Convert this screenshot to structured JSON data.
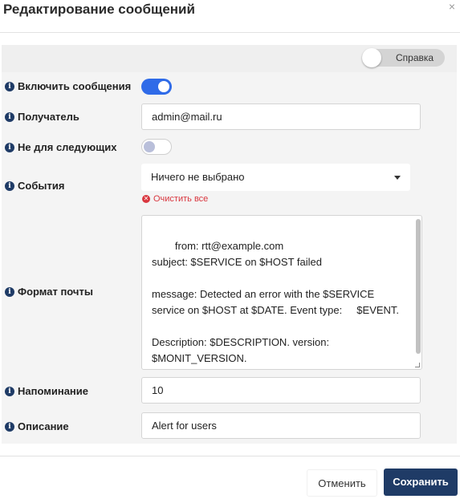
{
  "dialog": {
    "title": "Редактирование сообщений",
    "close_glyph": "×"
  },
  "help_toggle": {
    "label": "Справка",
    "enabled": false
  },
  "fields": {
    "enable_messages": {
      "label": "Включить сообщения",
      "enabled": true
    },
    "recipient": {
      "label": "Получатель",
      "value": "admin@mail.ru"
    },
    "not_for_following": {
      "label": "Не для следующих",
      "enabled": false
    },
    "events": {
      "label": "События",
      "value": "Ничего не выбрано",
      "clear_label": "Очистить все"
    },
    "mail_format": {
      "label": "Формат почты",
      "value": "from: rtt@example.com\nsubject: $SERVICE on $HOST failed\n\nmessage: Detected an error with the $SERVICE service on $HOST at $DATE. Event type:     $EVENT.\n\nDescription: $DESCRIPTION. version: $MONIT_VERSION."
    },
    "reminder": {
      "label": "Напоминание",
      "value": "10"
    },
    "description": {
      "label": "Описание",
      "value": "Alert for users"
    }
  },
  "footer": {
    "cancel_label": "Отменить",
    "save_label": "Сохранить"
  },
  "colors": {
    "primary": "#1f3b66",
    "toggle_on": "#2f6be8",
    "danger": "#d9363e"
  },
  "icons": {
    "info": "info-circle-icon",
    "clear": "times-circle-icon",
    "close": "close-icon",
    "caret": "caret-down-icon"
  }
}
